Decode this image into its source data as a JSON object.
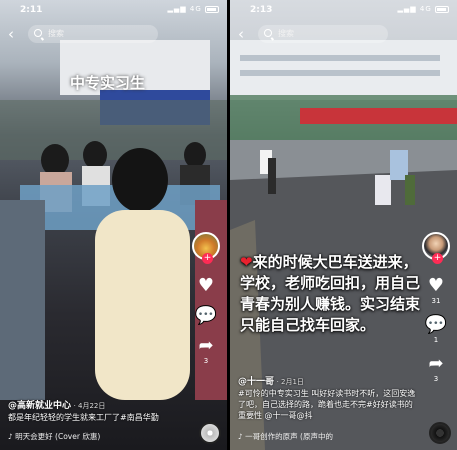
{
  "left": {
    "status": {
      "time": "2:11",
      "signal": "4G"
    },
    "search": {
      "placeholder": "搜索"
    },
    "overlay_title": "中专实习生",
    "rail": {
      "like_count": "",
      "comment_count": "",
      "share_count": "3"
    },
    "caption": {
      "author": "@高新就业中心",
      "date": "· 4月22日",
      "text": "都是年纪轻轻的学生就来工厂了#南昌华勤"
    },
    "music": "♪ 明天会更好 (Cover 欣惠)"
  },
  "right": {
    "status": {
      "time": "2:13",
      "signal": "4G"
    },
    "search": {
      "placeholder": "搜索"
    },
    "big_text_heart": "❤",
    "big_text": "来的时候大巴车送进来，学校，老师吃回扣，用自己青春为别人赚钱。实习结束只能自己找车回家。",
    "rail": {
      "like_count": "31",
      "comment_count": "1",
      "share_count": "3"
    },
    "caption": {
      "author": "@十一哥",
      "date": "· 2月1日",
      "text": "#可怜的中专实习生 叫好好读书时不听，这回安逸了吧，自己选择的路，跪着也走不完#好好读书的重要性 @十一哥@抖"
    },
    "music": "♪ 一哥创作的原声 (原声中的"
  }
}
